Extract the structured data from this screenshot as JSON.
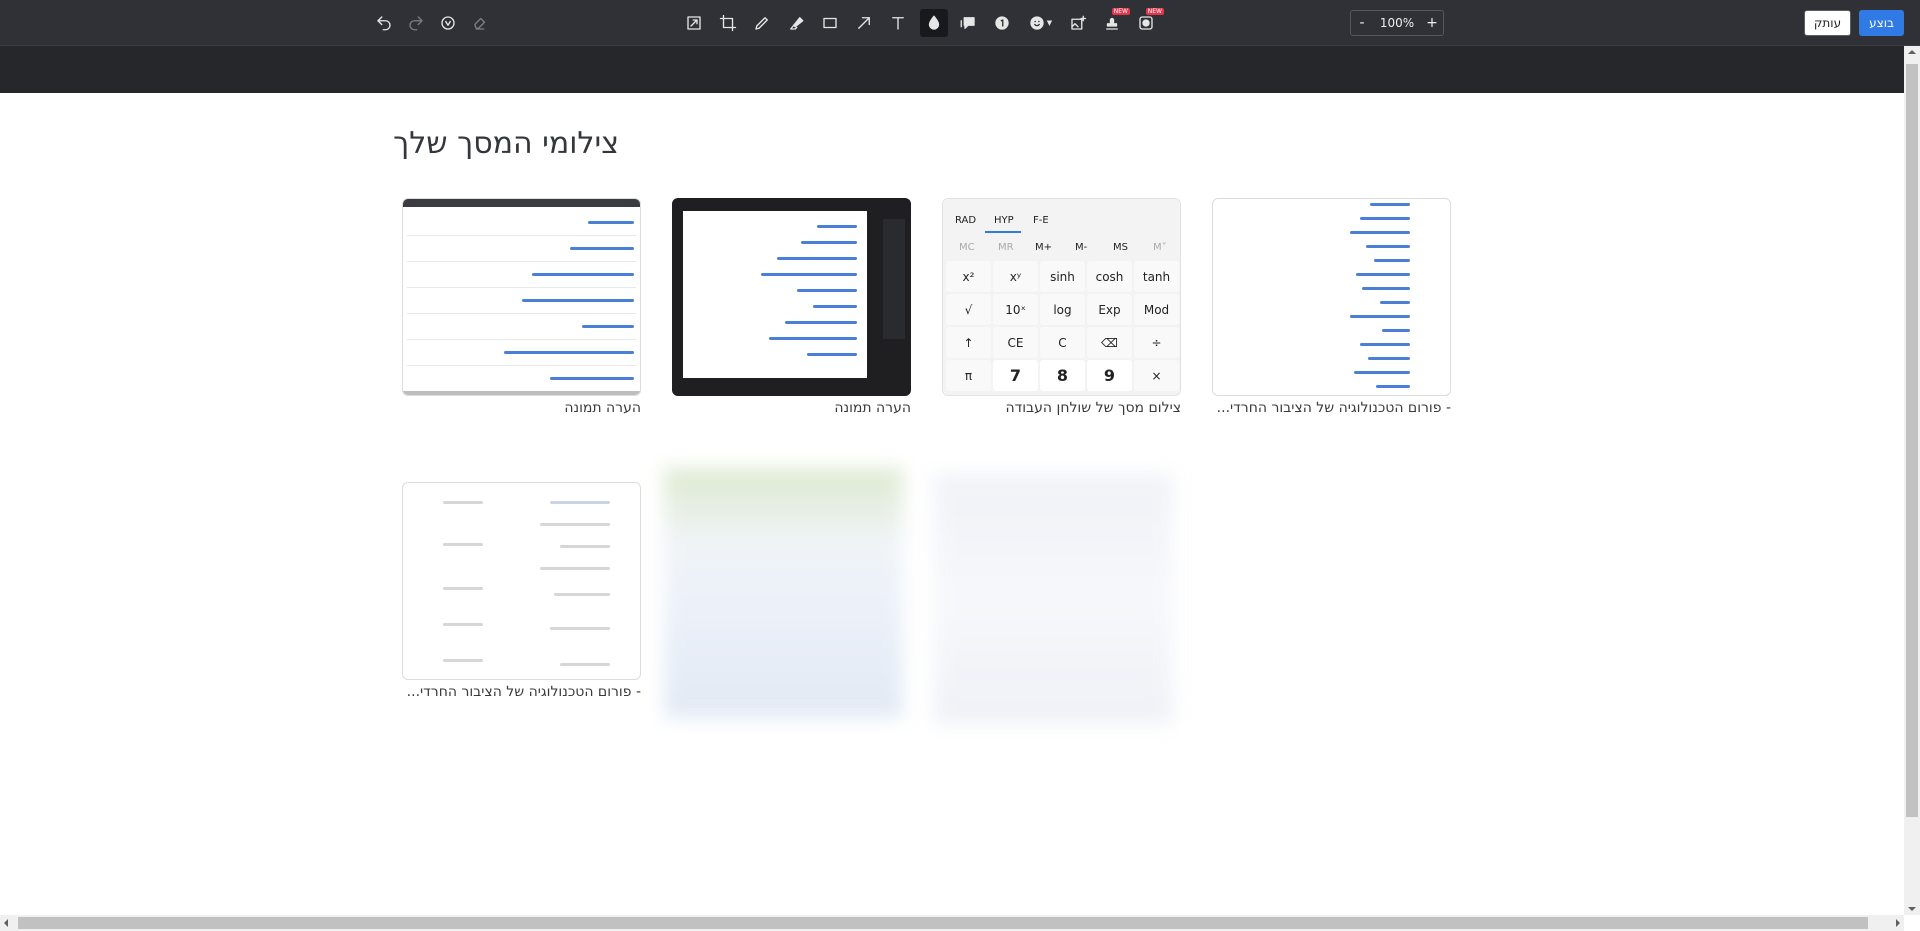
{
  "toolbar": {
    "zoom_value": "100%",
    "zoom_out_label": "-",
    "zoom_in_label": "+",
    "copy_label": "עותק",
    "done_label": "בוצע",
    "badge_new": "NEW",
    "tools": [
      "undo-icon",
      "redo-icon",
      "reset-icon",
      "eraser-icon",
      "resize-icon",
      "crop-icon",
      "pen-icon",
      "highlighter-icon",
      "rectangle-icon",
      "arrow-icon",
      "text-icon",
      "blur-drop-icon",
      "callout-icon",
      "step-number-icon",
      "emoji-icon",
      "image-insert-icon",
      "stamp-icon",
      "screen-record-icon"
    ]
  },
  "page": {
    "heading": "צילומי המסך שלך"
  },
  "gallery": [
    {
      "caption": "הערה תמונה"
    },
    {
      "caption": "הערה תמונה"
    },
    {
      "caption": "צילום מסך של שולחן העבודה"
    },
    {
      "caption": "- פורום הטכנולוגיה של הציבור החרדי..."
    },
    {
      "caption": "- פורום הטכנולוגיה של הציבור החרדי..."
    }
  ],
  "calculator": {
    "tabs": [
      "RAD",
      "HYP",
      "F-E"
    ],
    "memory": [
      "MC",
      "MR",
      "M+",
      "M-",
      "MS",
      "M˅"
    ],
    "keys": [
      [
        "x²",
        "xʸ",
        "sinh",
        "cosh",
        "tanh"
      ],
      [
        "√",
        "10ˣ",
        "log",
        "Exp",
        "Mod"
      ],
      [
        "↑",
        "CE",
        "C",
        "⌫",
        "÷"
      ],
      [
        "π",
        "7",
        "8",
        "9",
        "×"
      ]
    ]
  },
  "colors": {
    "toolbar_bg": "#2f3136",
    "accent": "#2f7ae5",
    "badge": "#e5354b"
  }
}
